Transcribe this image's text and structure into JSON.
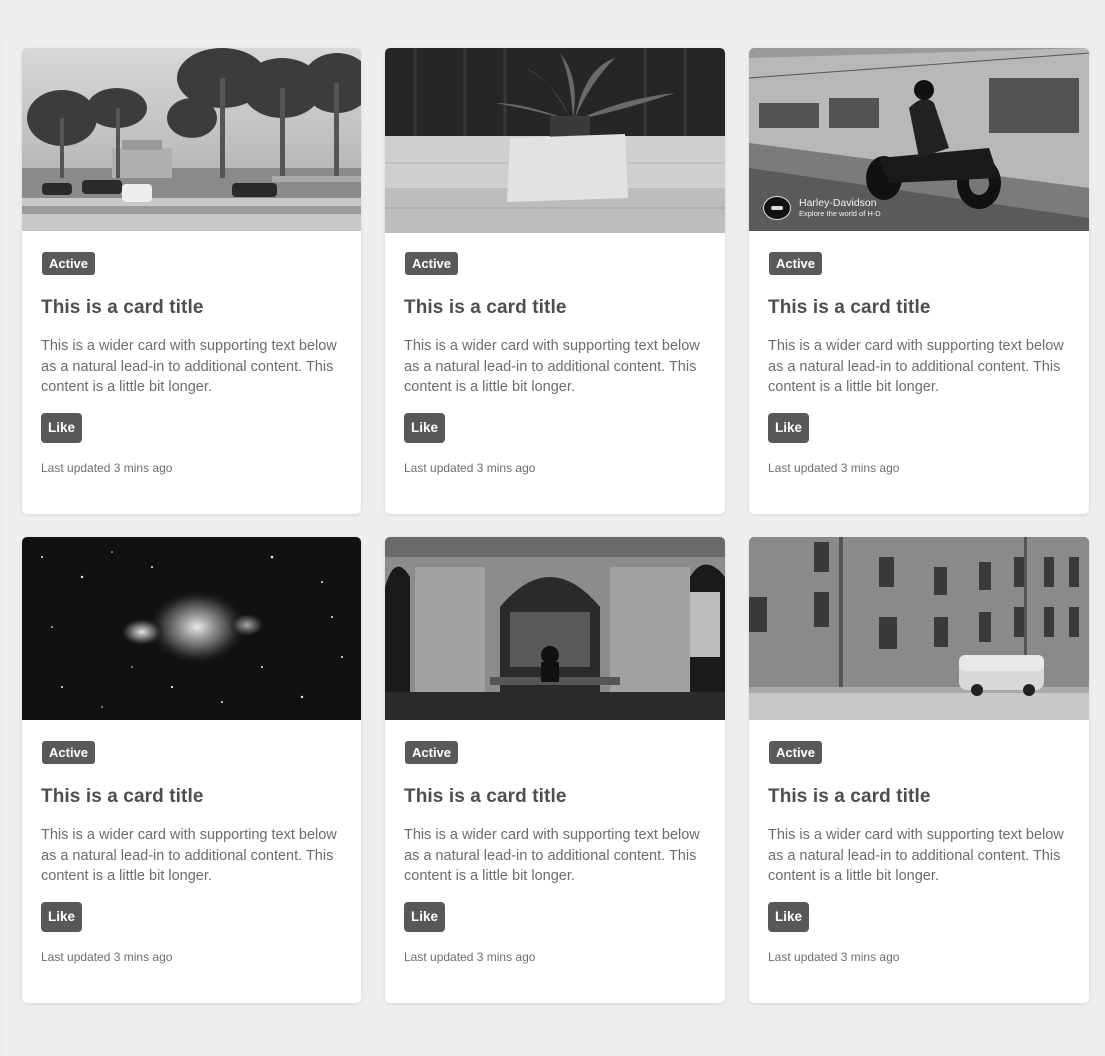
{
  "cards": [
    {
      "image": "palm-trees-street-photo",
      "badge": "Active",
      "title": "This is a card title",
      "text": "This is a wider card with supporting text below as a natural lead-in to additional content. This content is a little bit longer.",
      "button": "Like",
      "updated": "Last updated 3 mins ago"
    },
    {
      "image": "table-card-plant-photo",
      "badge": "Active",
      "title": "This is a card title",
      "text": "This is a wider card with supporting text below as a natural lead-in to additional content. This content is a little bit longer.",
      "button": "Like",
      "updated": "Last updated 3 mins ago"
    },
    {
      "image": "motorcycle-rider-photo",
      "badge": "Active",
      "title": "This is a card title",
      "text": "This is a wider card with supporting text below as a natural lead-in to additional content. This content is a little bit longer.",
      "button": "Like",
      "updated": "Last updated 3 mins ago",
      "overlay": {
        "brand": "Harley-Davidson",
        "tagline": "Explore the world of H-D"
      }
    },
    {
      "image": "nebula-starfield-photo",
      "badge": "Active",
      "title": "This is a card title",
      "text": "This is a wider card with supporting text below as a natural lead-in to additional content. This content is a little bit longer.",
      "button": "Like",
      "updated": "Last updated 3 mins ago"
    },
    {
      "image": "arched-window-bench-photo",
      "badge": "Active",
      "title": "This is a card title",
      "text": "This is a wider card with supporting text below as a natural lead-in to additional content. This content is a little bit longer.",
      "button": "Like",
      "updated": "Last updated 3 mins ago"
    },
    {
      "image": "brick-building-van-photo",
      "badge": "Active",
      "title": "This is a card title",
      "text": "This is a wider card with supporting text below as a natural lead-in to additional content. This content is a little bit longer.",
      "button": "Like",
      "updated": "Last updated 3 mins ago"
    }
  ]
}
